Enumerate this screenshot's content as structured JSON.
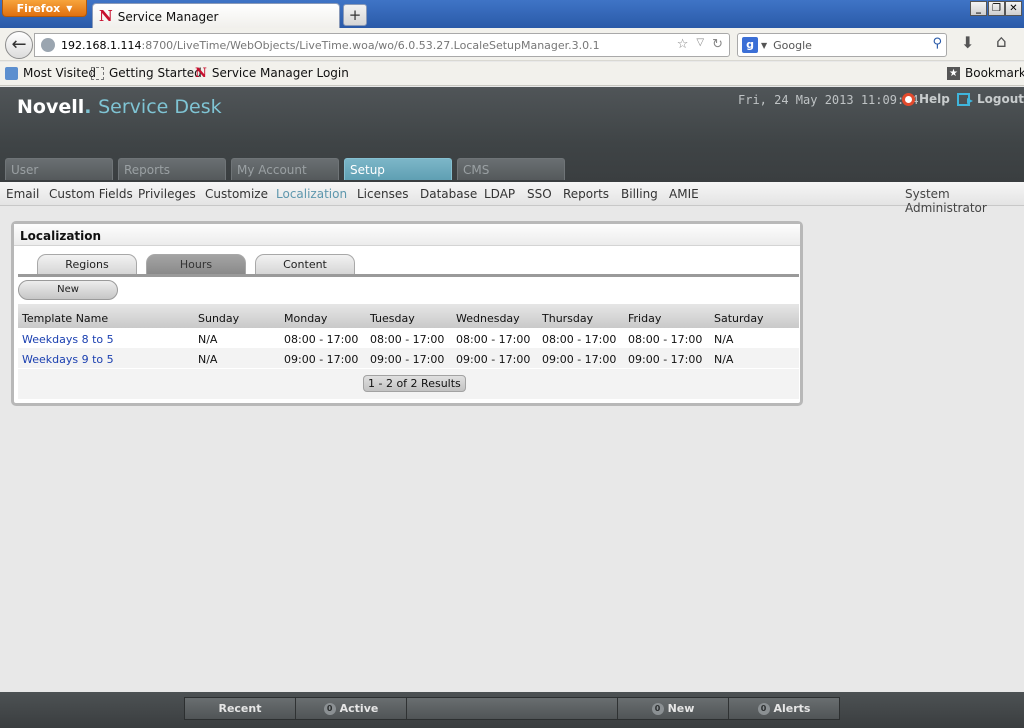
{
  "browser": {
    "app_button": "Firefox",
    "tab_title": "Service Manager",
    "new_tab": "+",
    "url_host": "192.168.1.114",
    "url_rest": ":8700/LiveTime/WebObjects/LiveTime.woa/wo/6.0.53.27.LocaleSetupManager.3.0.1",
    "search_placeholder": "Google",
    "bookmarks": [
      "Most Visited",
      "Getting Started",
      "Service Manager Login"
    ],
    "bookmarks_menu": "Bookmarks"
  },
  "app": {
    "brand_novell": "Novell",
    "brand_sd": "Service Desk",
    "datetime": "Fri, 24 May 2013 11:09:04",
    "help": "Help",
    "logout": "Logout",
    "main_tabs": [
      "User",
      "Reports",
      "My Account",
      "Setup",
      "CMS"
    ],
    "active_main_tab": "Setup",
    "sub_nav": [
      "Email",
      "Custom Fields",
      "Privileges",
      "Customize",
      "Localization",
      "Licenses",
      "Database",
      "LDAP",
      "SSO",
      "Reports",
      "Billing",
      "AMIE"
    ],
    "active_sub_nav": "Localization",
    "user_role": "System Administrator"
  },
  "panel": {
    "title": "Localization",
    "tabs": [
      "Regions",
      "Hours",
      "Content"
    ],
    "active_tab": "Hours",
    "new_button": "New",
    "columns": [
      "Template Name",
      "Sunday",
      "Monday",
      "Tuesday",
      "Wednesday",
      "Thursday",
      "Friday",
      "Saturday"
    ],
    "rows": [
      [
        "Weekdays 8 to 5",
        "N/A",
        "08:00 - 17:00",
        "08:00 - 17:00",
        "08:00 - 17:00",
        "08:00 - 17:00",
        "08:00 - 17:00",
        "N/A"
      ],
      [
        "Weekdays 9 to 5",
        "N/A",
        "09:00 - 17:00",
        "09:00 - 17:00",
        "09:00 - 17:00",
        "09:00 - 17:00",
        "09:00 - 17:00",
        "N/A"
      ]
    ],
    "results": "1 - 2 of 2 Results"
  },
  "bottom_bar": {
    "recent": "Recent",
    "active": "Active",
    "active_count": "0",
    "new": "New",
    "new_count": "0",
    "alerts": "Alerts",
    "alerts_count": "0"
  }
}
